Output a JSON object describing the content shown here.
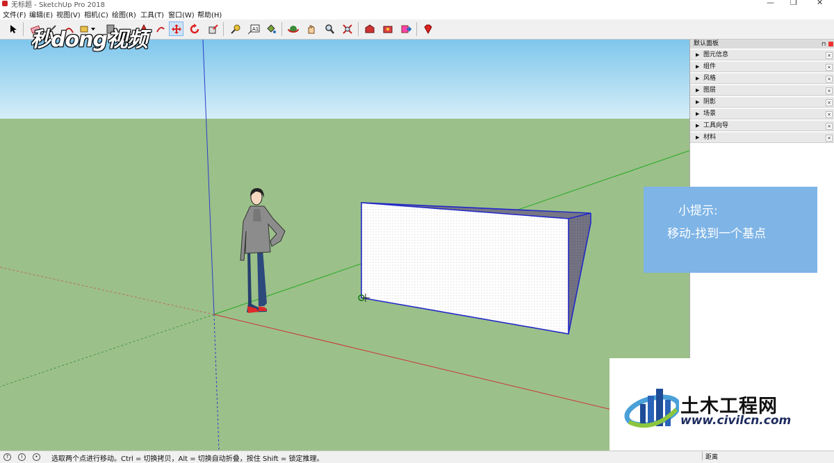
{
  "window": {
    "title": "无标题 - SketchUp Pro 2018"
  },
  "menu": [
    "文件(F)",
    "编辑(E)",
    "视图(V)",
    "相机(C)",
    "绘图(R)",
    "工具(T)",
    "窗口(W)",
    "帮助(H)"
  ],
  "watermark": "秒dong视频",
  "tip": {
    "line1": "小提示:",
    "line2": "移动-找到一个基点"
  },
  "panel": {
    "title": "默认面板",
    "items": [
      "图元信息",
      "组件",
      "风格",
      "图层",
      "阴影",
      "场景",
      "工具向导",
      "材料"
    ]
  },
  "logo": {
    "brand": "土木工程网",
    "url": "www.civilcn.com"
  },
  "status": {
    "text": "选取两个点进行移动。Ctrl = 切换拷贝，Alt = 切换自动折叠，按住 Shift = 锁定推理。",
    "measure_label": "距离"
  },
  "colors": {
    "sky": "#7ec6ec",
    "ground": "#9cc08a",
    "tip": "#7eb4e6",
    "box_edge": "#2228c8"
  }
}
